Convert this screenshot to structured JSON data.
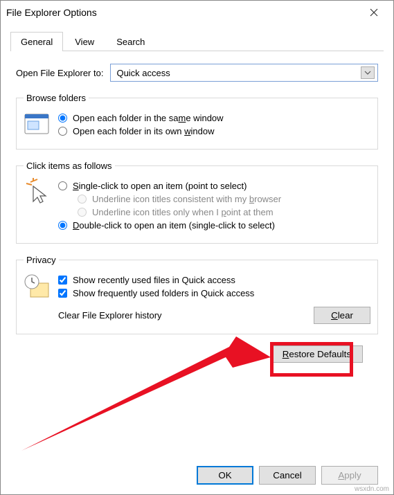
{
  "window": {
    "title": "File Explorer Options"
  },
  "tabs": {
    "general": "General",
    "view": "View",
    "search": "Search"
  },
  "open_to": {
    "label": "Open File Explorer to:",
    "value": "Quick access"
  },
  "browse": {
    "legend": "Browse folders",
    "same": "Open each folder in the same window",
    "own": "Open each folder in its own window"
  },
  "click": {
    "legend": "Click items as follows",
    "single": "Single-click to open an item (point to select)",
    "ul_browser": "Underline icon titles consistent with my browser",
    "ul_point": "Underline icon titles only when I point at them",
    "double": "Double-click to open an item (single-click to select)"
  },
  "privacy": {
    "legend": "Privacy",
    "recent": "Show recently used files in Quick access",
    "frequent": "Show frequently used folders in Quick access",
    "clear_label": "Clear File Explorer history",
    "clear_btn": "Clear"
  },
  "restore": "Restore Defaults",
  "footer": {
    "ok": "OK",
    "cancel": "Cancel",
    "apply": "Apply"
  },
  "watermark": "wsxdn.com"
}
